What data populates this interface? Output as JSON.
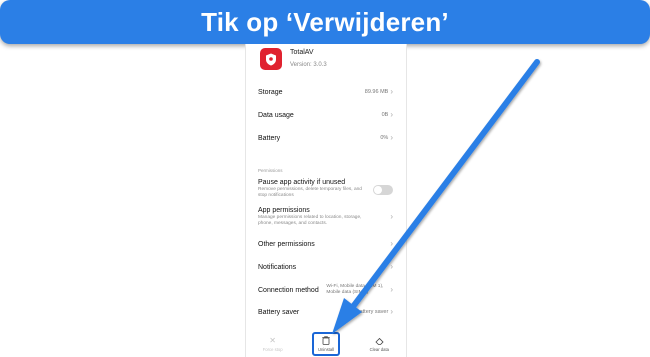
{
  "banner": {
    "text": "Tik op ‘Verwijderen’"
  },
  "app": {
    "name": "TotalAV",
    "version": "Version: 3.0.3"
  },
  "rows": [
    {
      "label": "Storage",
      "value": "89.96 MB"
    },
    {
      "label": "Data usage",
      "value": "0B"
    },
    {
      "label": "Battery",
      "value": "0%"
    }
  ],
  "permissions": {
    "section_label": "Permissions",
    "pause": {
      "title": "Pause app activity if unused",
      "desc": "Remove permissions, delete temporary files, and stop notifications"
    },
    "app_permissions": {
      "title": "App permissions",
      "desc": "Manage permissions related to location, storage, phone, messages, and contacts."
    }
  },
  "more_rows": [
    {
      "label": "Other permissions",
      "value": ""
    },
    {
      "label": "Notifications",
      "value": ""
    },
    {
      "label": "Connection method",
      "value": "Wi-Fi, Mobile data (SIM 1), Mobile data (SIM 2)"
    },
    {
      "label": "Battery saver",
      "value": "battery saver"
    }
  ],
  "bottom_bar": {
    "force_stop": "Force stop",
    "uninstall": "Uninstall",
    "clear_data": "Clear data"
  },
  "colors": {
    "banner": "#2b7fe6",
    "arrow": "#2b7fe6",
    "app_icon": "#e0222f",
    "highlight": "#1a66d6"
  },
  "icons": {
    "app": "shield-icon",
    "force_stop": "x-icon",
    "uninstall": "trash-icon",
    "clear_data": "eraser-icon"
  }
}
